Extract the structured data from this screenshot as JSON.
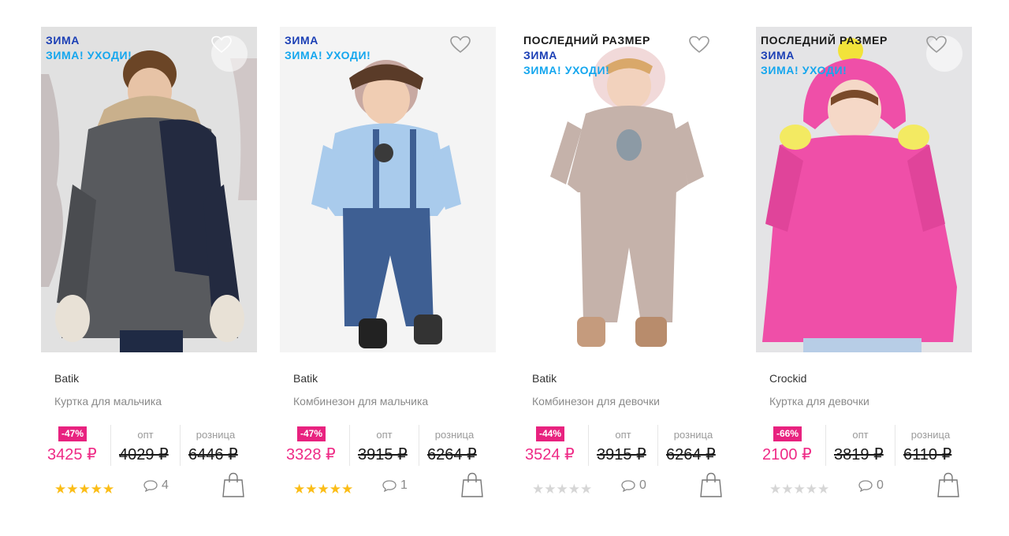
{
  "products": [
    {
      "badges": [
        "ЗИМА",
        "ЗИМА! УХОДИ!"
      ],
      "badge_types": [
        "zima",
        "uhodi"
      ],
      "brand": "Batik",
      "name": "Куртка для мальчика",
      "discount": "-47%",
      "price": "3425 ₽",
      "opt_label": "опт",
      "opt_price": "4029 ₽",
      "retail_label": "розница",
      "retail_price": "6446 ₽",
      "rating_stars": "★★★★★",
      "rated": true,
      "comments": "4",
      "fav_icon": "heart-icon",
      "garment_color": "#585a5e",
      "accent_color": "#232a40",
      "bg_color": "#dcdcdc"
    },
    {
      "badges": [
        "ЗИМА",
        "ЗИМА! УХОДИ!"
      ],
      "badge_types": [
        "zima",
        "uhodi"
      ],
      "brand": "Batik",
      "name": "Комбинезон для мальчика",
      "discount": "-47%",
      "price": "3328 ₽",
      "opt_label": "опт",
      "opt_price": "3915 ₽",
      "retail_label": "розница",
      "retail_price": "6264 ₽",
      "rating_stars": "★★★★★",
      "rated": true,
      "comments": "1",
      "fav_icon": "heart-icon",
      "garment_color": "#a9cbec",
      "accent_color": "#3e5f93",
      "bg_color": "#f4f4f4"
    },
    {
      "badges": [
        "ПОСЛЕДНИЙ РАЗМЕР",
        "ЗИМА",
        "ЗИМА! УХОДИ!"
      ],
      "badge_types": [
        "last",
        "zima",
        "uhodi"
      ],
      "brand": "Batik",
      "name": "Комбинезон для девочки",
      "discount": "-44%",
      "price": "3524 ₽",
      "opt_label": "опт",
      "opt_price": "3915 ₽",
      "retail_label": "розница",
      "retail_price": "6264 ₽",
      "rating_stars": "★★★★★",
      "rated": false,
      "comments": "0",
      "fav_icon": "heart-icon",
      "garment_color": "#c5b2aa",
      "accent_color": "#a58f86",
      "bg_color": "#ffffff"
    },
    {
      "badges": [
        "ПОСЛЕДНИЙ РАЗМЕР",
        "ЗИМА",
        "ЗИМА! УХОДИ!"
      ],
      "badge_types": [
        "last",
        "zima",
        "uhodi"
      ],
      "brand": "Crockid",
      "name": "Куртка для девочки",
      "discount": "-66%",
      "price": "2100 ₽",
      "opt_label": "опт",
      "opt_price": "3819 ₽",
      "retail_label": "розница",
      "retail_price": "6110 ₽",
      "rating_stars": "★★★★★",
      "rated": false,
      "comments": "0",
      "fav_icon": "heart-icon",
      "garment_color": "#ef4fa8",
      "accent_color": "#c9338a",
      "bg_color": "#e4e4e6"
    }
  ]
}
